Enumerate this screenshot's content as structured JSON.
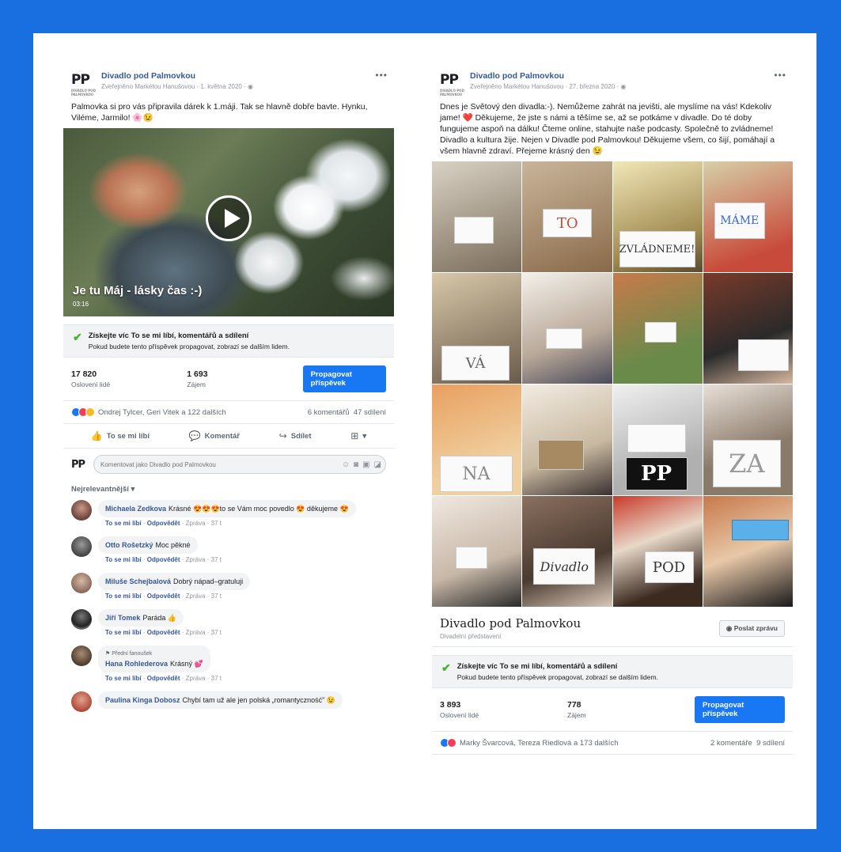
{
  "left_post": {
    "page_name": "Divadlo pod Palmovkou",
    "meta": "Zveřejněno Markétou Hanušovou · 1. května 2020 ·",
    "text": "Palmovka si pro vás připravila dárek k 1.máji. Tak se hlavně dobře bavte. Hynku, Viléme, Jarmilo!",
    "video_title": "Je tu Máj - lásky čas :-)",
    "video_duration": "03:16",
    "promo_title": "Získejte víc To se mi líbí, komentářů a sdílení",
    "promo_sub": "Pokud budete tento příspěvek propagovat, zobrazí se dalším lidem.",
    "reach_num": "17 820",
    "reach_label": "Oslovení lidé",
    "engage_num": "1 693",
    "engage_label": "Zájem",
    "promote_label": "Propagovat příspěvek",
    "reactions_names": "Ondrej Tylcer, Geri Vitek a 122 dalších",
    "comments_count": "6 komentářů",
    "shares_count": "47 sdílení",
    "like_label": "To se mi líbí",
    "comment_label": "Komentář",
    "share_label": "Sdílet",
    "comment_placeholder": "Komentovat jako Divadlo pod Palmovkou",
    "sort_label": "Nejrelevantnější ▾",
    "comments": [
      {
        "author": "Michaela Zedkova",
        "text": "Krásné 😍😍😍to se Vám moc povedlo 😍 děkujeme 😍",
        "tag": "",
        "like": "To se mi líbí",
        "reply": "Odpovědět",
        "meta": "· Zpráva · 37 t"
      },
      {
        "author": "Otto Rošetzký",
        "text": "Moc pěkné",
        "tag": "",
        "like": "To se mi líbí",
        "reply": "Odpovědět",
        "meta": "· Zpráva · 37 t"
      },
      {
        "author": "Miluše Schejbalová",
        "text": "Dobrý nápad–gratuluji",
        "tag": "",
        "like": "To se mi líbí",
        "reply": "Odpovědět",
        "meta": "· Zpráva · 37 t"
      },
      {
        "author": "Jiří Tomek",
        "text": "Paráda 👍",
        "tag": "",
        "like": "To se mi líbí",
        "reply": "Odpovědět",
        "meta": "· Zpráva · 37 t"
      },
      {
        "author": "Hana Rohlederova",
        "text": "Krásný 💕",
        "tag": "Přední fanoušek",
        "like": "To se mi líbí",
        "reply": "Odpovědět",
        "meta": "· Zpráva · 37 t"
      },
      {
        "author": "Paulina Kinga Dobosz",
        "text": "Chybí tam už ale jen polská „romantyczność\" 😉",
        "tag": "",
        "like": "",
        "reply": "",
        "meta": ""
      }
    ]
  },
  "right_post": {
    "page_name": "Divadlo pod Palmovkou",
    "meta": "Zveřejněno Markétou Hanušovou · 27. března 2020 ·",
    "text": "Dnes je Světový den divadla:-). Nemůžeme zahrát na jevišti, ale myslíme na vás! Kdekoliv jame! ❤️ Děkujeme, že jste s námi a těšíme se, až se potkáme v divadle. Do té doby fungujeme aspoň na dálku! Čteme online, stahujte naše podcasty. Společně to zvládneme! Divadlo a kultura žije. Nejen v Divadle pod Palmovkou! Děkujeme všem, co šijí, pomáhají a všem hlavně zdraví. Přejeme krásný den 😉",
    "signs": [
      "TO",
      "MÁME",
      "ZVLÁDNEME!",
      "VÁ",
      "NA",
      "PP",
      "ZA",
      "Divadlo",
      "POD"
    ],
    "page_card_name": "Divadlo pod Palmovkou",
    "page_card_category": "Divadelní představení",
    "message_label": "Poslat zprávu",
    "promo_title": "Získejte víc To se mi líbí, komentářů a sdílení",
    "promo_sub": "Pokud budete tento příspěvek propagovat, zobrazí se dalším lidem.",
    "reach_num": "3 893",
    "reach_label": "Oslovení lidé",
    "engage_num": "778",
    "engage_label": "Zájem",
    "promote_label": "Propagovat příspěvek",
    "reactions_names": "Marky Švarcová, Tereza Riedlová a 173 dalších",
    "comments_count": "2 komentáře",
    "shares_count": "9 sdílení"
  },
  "colors": {
    "frame_blue": "#1a6fe0",
    "fb_blue": "#1877f2",
    "link_blue": "#365899",
    "success_green": "#42b72a"
  }
}
